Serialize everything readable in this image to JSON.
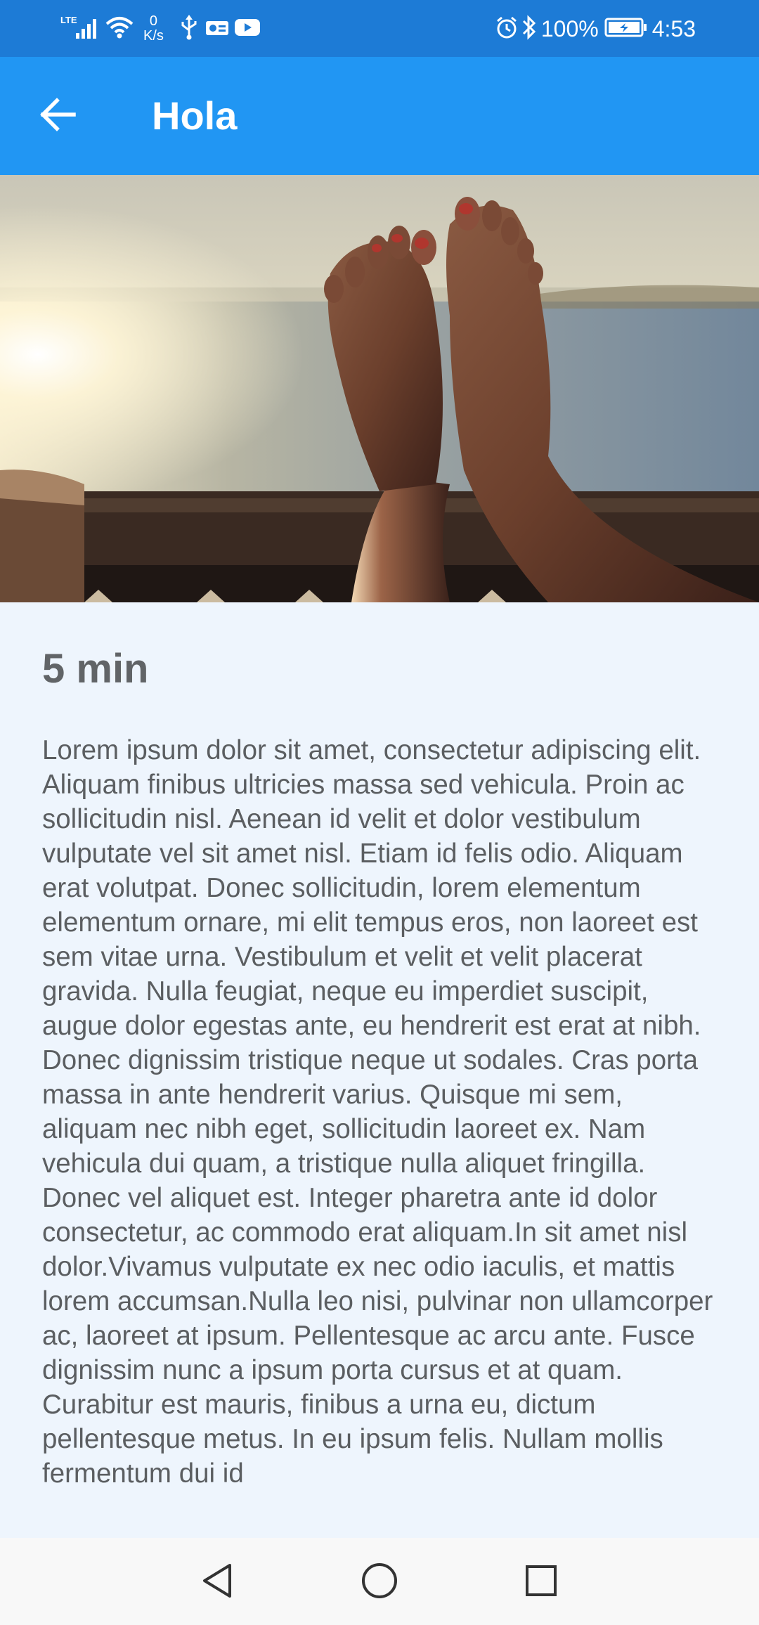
{
  "status_bar": {
    "network_label": "LTE",
    "net_speed_value": "0",
    "net_speed_unit": "K/s",
    "battery_percent": "100%",
    "time": "4:53",
    "icons": [
      "lte-signal-icon",
      "wifi-icon",
      "usb-icon",
      "vpn-icon",
      "youtube-icon",
      "alarm-icon",
      "bluetooth-icon",
      "battery-charging-icon"
    ]
  },
  "app_bar": {
    "title": "Hola",
    "back_icon": "arrow-back-icon",
    "color": "#2196f3"
  },
  "hero_image": {
    "description_icon": "beach-feet-photo"
  },
  "content": {
    "duration": "5 min",
    "body": "Lorem ipsum dolor sit amet, consectetur adipiscing elit. Aliquam finibus ultricies massa sed vehicula. Proin ac sollicitudin nisl. Aenean id velit et dolor vestibulum vulputate vel sit amet nisl. Etiam id felis odio. Aliquam erat volutpat. Donec sollicitudin, lorem elementum elementum ornare, mi elit tempus eros, non laoreet est sem vitae urna. Vestibulum et velit et velit placerat gravida. Nulla feugiat, neque eu imperdiet suscipit, augue dolor egestas ante, eu hendrerit est erat at nibh. Donec dignissim tristique neque ut sodales. Cras porta massa in ante hendrerit varius. Quisque mi sem, aliquam nec nibh eget, sollicitudin laoreet ex. Nam vehicula dui quam, a tristique nulla aliquet fringilla. Donec vel aliquet est. Integer pharetra ante id dolor consectetur, ac commodo erat aliquam.In sit amet nisl dolor.Vivamus vulputate ex nec odio iaculis, et mattis lorem accumsan.Nulla leo nisi, pulvinar non ullamcorper ac, laoreet at ipsum. Pellentesque ac arcu ante. Fusce dignissim nunc a ipsum porta cursus et at quam. Curabitur est mauris, finibus a urna eu, dictum pellentesque metus. In eu ipsum felis. Nullam mollis fermentum dui id"
  },
  "nav_bar": {
    "back": "nav-back-triangle-icon",
    "home": "nav-home-circle-icon",
    "recents": "nav-recents-square-icon"
  }
}
